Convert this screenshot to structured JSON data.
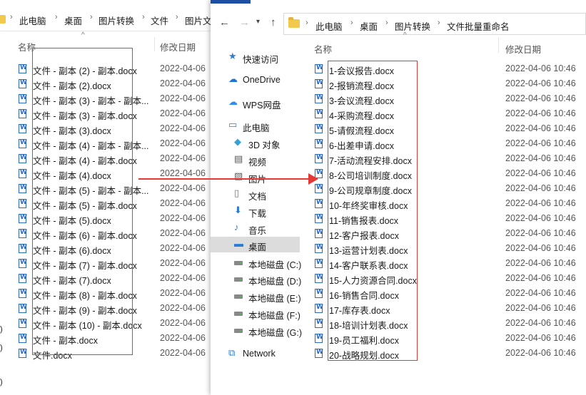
{
  "back": {
    "breadcrumbs": [
      "此电脑",
      "桌面",
      "图片转换",
      "文件",
      "图片文"
    ],
    "col_name": "名称",
    "col_date": "修改日期",
    "files": [
      "文件 - 副本 (2) - 副本.docx",
      "文件 - 副本 (2).docx",
      "文件 - 副本 (3) - 副本 - 副本...",
      "文件 - 副本 (3) - 副本.docx",
      "文件 - 副本 (3).docx",
      "文件 - 副本 (4) - 副本 - 副本...",
      "文件 - 副本 (4) - 副本.docx",
      "文件 - 副本 (4).docx",
      "文件 - 副本 (5) - 副本 - 副本...",
      "文件 - 副本 (5) - 副本.docx",
      "文件 - 副本 (5).docx",
      "文件 - 副本 (6) - 副本.docx",
      "文件 - 副本 (6).docx",
      "文件 - 副本 (7) - 副本.docx",
      "文件 - 副本 (7).docx",
      "文件 - 副本 (8) - 副本.docx",
      "文件 - 副本 (9) - 副本.docx",
      "文件 - 副本 (10) - 副本.docx",
      "文件 - 副本.docx",
      "文件.docx"
    ],
    "date": "2022-04-06",
    "edge_marks": [
      ")",
      ")",
      ")"
    ]
  },
  "front": {
    "breadcrumbs": [
      "此电脑",
      "桌面",
      "图片转换",
      "文件批量重命名"
    ],
    "col_name": "名称",
    "col_date": "修改日期",
    "nav": [
      {
        "label": "快速访问",
        "icon": "star-icon"
      },
      {
        "label": "OneDrive",
        "icon": "cloud-icon"
      },
      {
        "label": "WPS网盘",
        "icon": "wps-cloud-icon"
      },
      {
        "label": "此电脑",
        "icon": "computer-icon"
      },
      {
        "label": "3D 对象",
        "icon": "cube-icon"
      },
      {
        "label": "视频",
        "icon": "video-icon"
      },
      {
        "label": "图片",
        "icon": "picture-icon"
      },
      {
        "label": "文档",
        "icon": "document-icon"
      },
      {
        "label": "下载",
        "icon": "download-icon"
      },
      {
        "label": "音乐",
        "icon": "music-icon"
      },
      {
        "label": "桌面",
        "icon": "desktop-icon"
      },
      {
        "label": "本地磁盘 (C:)",
        "icon": "drive-icon"
      },
      {
        "label": "本地磁盘 (D:)",
        "icon": "drive-icon"
      },
      {
        "label": "本地磁盘 (E:)",
        "icon": "drive-icon"
      },
      {
        "label": "本地磁盘 (F:)",
        "icon": "drive-icon"
      },
      {
        "label": "本地磁盘 (G:)",
        "icon": "drive-icon"
      },
      {
        "label": "Network",
        "icon": "network-icon"
      }
    ],
    "files": [
      "1-会议报告.docx",
      "2-报销流程.docx",
      "3-会议流程.docx",
      "4-采购流程.docx",
      "5-请假流程.docx",
      "6-出差申请.docx",
      "7-活动流程安排.docx",
      "8-公司培训制度.docx",
      "9-公司规章制度.docx",
      "10-年终奖审核.docx",
      "11-销售报表.docx",
      "12-客户报表.docx",
      "13-运营计划表.docx",
      "14-客户联系表.docx",
      "15-人力资源合同.docx",
      "16-销售合同.docx",
      "17-库存表.docx",
      "18-培训计划表.docx",
      "19-员工福利.docx",
      "20-战略规划.docx"
    ],
    "date": "2022-04-06 10:46"
  },
  "colors": {
    "highlight_red": "#e53935",
    "accent_blue": "#1f4fa3",
    "selected_bg": "#dcdcdc"
  }
}
